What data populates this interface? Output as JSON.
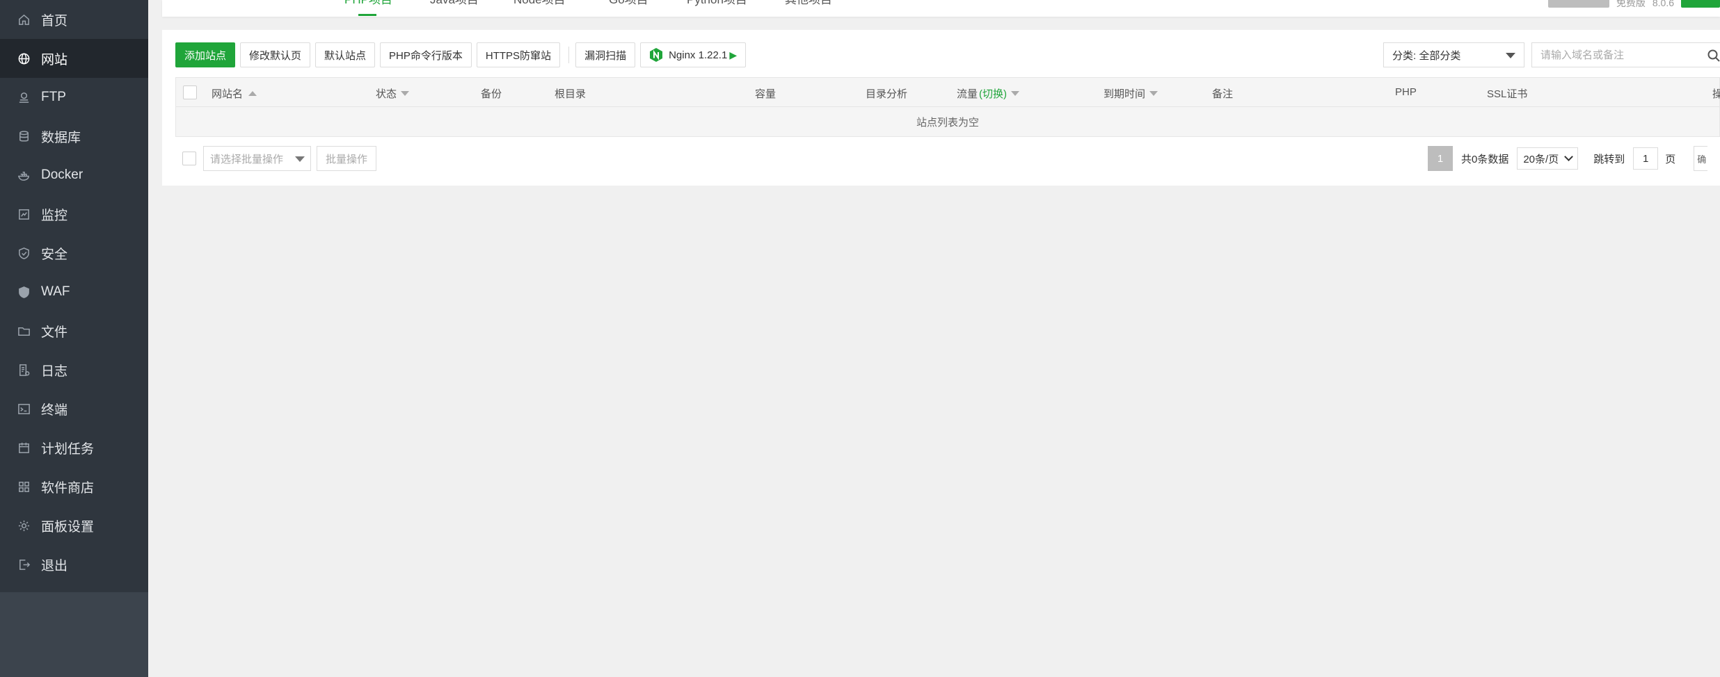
{
  "sidebar": {
    "items": [
      {
        "label": "首页",
        "icon": "home-icon"
      },
      {
        "label": "网站",
        "icon": "globe-icon",
        "active": true
      },
      {
        "label": "FTP",
        "icon": "ftp-icon"
      },
      {
        "label": "数据库",
        "icon": "database-icon"
      },
      {
        "label": "Docker",
        "icon": "docker-icon"
      },
      {
        "label": "监控",
        "icon": "monitor-icon"
      },
      {
        "label": "安全",
        "icon": "shield-icon"
      },
      {
        "label": "WAF",
        "icon": "waf-shield-icon"
      },
      {
        "label": "文件",
        "icon": "folder-icon"
      },
      {
        "label": "日志",
        "icon": "log-icon"
      },
      {
        "label": "终端",
        "icon": "terminal-icon"
      },
      {
        "label": "计划任务",
        "icon": "calendar-icon"
      },
      {
        "label": "软件商店",
        "icon": "apps-icon"
      },
      {
        "label": "面板设置",
        "icon": "gear-icon"
      },
      {
        "label": "退出",
        "icon": "logout-icon"
      }
    ]
  },
  "topbar": {
    "tabs": [
      "PHP项目",
      "Java项目",
      "Node项目",
      "Go项目",
      "Python项目",
      "其他项目"
    ],
    "right_text_1": "免费版",
    "right_text_2": "8.0.6"
  },
  "toolbar": {
    "add_site": "添加站点",
    "modify_default_page": "修改默认页",
    "default_site": "默认站点",
    "php_cli_version": "PHP命令行版本",
    "https_anti_block": "HTTPS防窜站",
    "vuln_scan": "漏洞扫描",
    "nginx_version": "Nginx 1.22.1"
  },
  "filter": {
    "category": "分类: 全部分类",
    "search_placeholder": "请输入域名或备注"
  },
  "table": {
    "headers": {
      "site_name": "网站名",
      "status": "状态",
      "backup": "备份",
      "root_dir": "根目录",
      "capacity": "容量",
      "dir_analysis": "目录分析",
      "traffic": "流量",
      "traffic_switch": "(切换)",
      "expire": "到期时间",
      "remark": "备注",
      "php": "PHP",
      "ssl": "SSL证书",
      "ops": "操"
    },
    "empty_text": "站点列表为空"
  },
  "footer": {
    "batch_placeholder": "请选择批量操作",
    "batch_button": "批量操作",
    "current_page": "1",
    "total": "共0条数据",
    "per_page": "20条/页",
    "jump_to": "跳转到",
    "jump_value": "1",
    "page_unit": "页",
    "confirm": "确"
  },
  "colors": {
    "accent": "#20a53a",
    "sidebar_bg": "#3c444d",
    "sidebar_nav_bg": "#2f363e",
    "sidebar_active_bg": "#22272d"
  }
}
